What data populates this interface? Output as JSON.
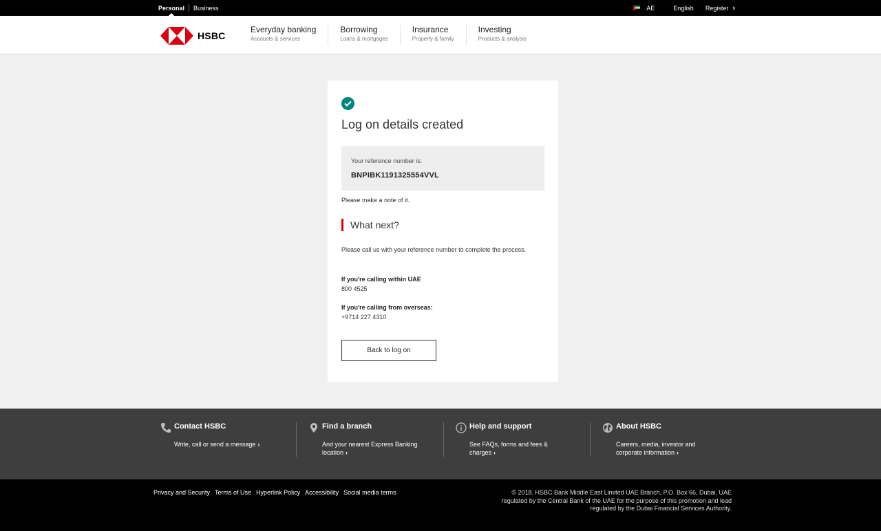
{
  "topbar": {
    "tabs": [
      {
        "label": "Personal",
        "active": true
      },
      {
        "label": "Business",
        "active": false
      }
    ],
    "region": "AE",
    "language": "English",
    "register": "Register"
  },
  "header": {
    "brand": "HSBC",
    "nav": [
      {
        "title": "Everyday banking",
        "subtitle": "Accounts & services"
      },
      {
        "title": "Borrowing",
        "subtitle": "Loans & mortgages"
      },
      {
        "title": "Insurance",
        "subtitle": "Property & family"
      },
      {
        "title": "Investing",
        "subtitle": "Products & analysis"
      }
    ]
  },
  "main": {
    "title": "Log on details created",
    "reference_label": "Your reference number is:",
    "reference_number": "BNPIBK1191325554VVL",
    "note": "Please make a note of it.",
    "next_heading": "What next?",
    "instruction": "Please call us with your reference number to complete the process.",
    "within_label": "If you're calling within UAE",
    "within_number": "800 4525",
    "overseas_label": "If you're calling from overseas:",
    "overseas_number": "+9714 227 4310",
    "back_button": "Back to log on"
  },
  "footer": {
    "columns": [
      {
        "icon": "phone-icon",
        "title": "Contact HSBC",
        "desc": "Write, call or send a message"
      },
      {
        "icon": "location-pin-icon",
        "title": "Find a branch",
        "desc": "And your nearest Express Banking location"
      },
      {
        "icon": "info-icon",
        "title": "Help and support",
        "desc": "See FAQs, forms and fees & charges"
      },
      {
        "icon": "globe-icon",
        "title": "About HSBC",
        "desc": "Careers, media, investor and corporate information"
      }
    ],
    "links": [
      "Privacy and Security",
      "Terms of Use",
      "Hyperlink Policy",
      "Accessibility",
      "Social media terms"
    ],
    "copyright": "© 2018. HSBC Bank Middle East Limited UAE Branch, P.O. Box 66, Dubai, UAE regulated by the Central Bank of the UAE for the purpose of this promotion and lead regulated by the Dubai Financial Services Authority."
  },
  "colors": {
    "brand_red": "#db0011",
    "success_teal": "#00847f",
    "footer_bg": "#3e3e3e"
  }
}
